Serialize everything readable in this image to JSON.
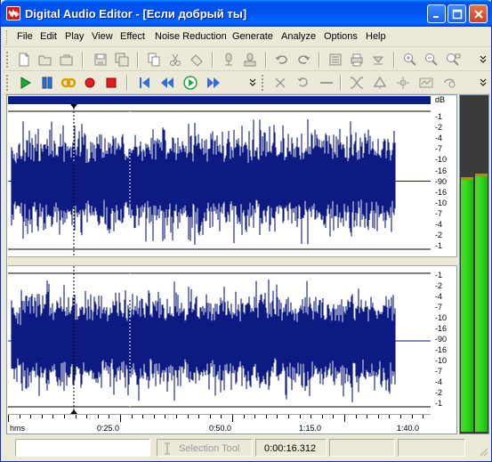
{
  "window": {
    "title": "Digital Audio Editor - [Если  добрый  ты]"
  },
  "menu": {
    "items": [
      "File",
      "Edit",
      "Play",
      "View",
      "Effect",
      "Noise Reduction",
      "Generate",
      "Analyze",
      "Options",
      "Help"
    ]
  },
  "toolbar1": {
    "icons": [
      "new-icon",
      "open-icon",
      "open-folder-icon",
      "save-icon",
      "save-all-icon",
      "copy-icon",
      "cut-icon",
      "paste-icon",
      "mic-icon",
      "mic-record-icon",
      "undo-icon",
      "redo-icon",
      "properties-icon",
      "print-icon",
      "down-arrow-icon",
      "zoom-in-icon",
      "zoom-out-icon",
      "zoom-fit-icon"
    ]
  },
  "toolbar2": {
    "icons": [
      "play-icon",
      "pause-icon",
      "loop-icon",
      "record-icon",
      "stop-icon",
      "go-start-icon",
      "rewind-icon",
      "play-cursor-icon",
      "fast-forward-icon"
    ],
    "right_icons": [
      "scissors-icon",
      "rotate-icon",
      "line-icon",
      "crossfade-icon",
      "marker-icon",
      "sparkle-icon",
      "equalizer-icon",
      "reverse-icon"
    ]
  },
  "db_scale_top": {
    "unit": "dB",
    "labels": [
      "-1",
      "-2",
      "-4",
      "-7",
      "-10",
      "-16",
      "-90",
      "-16",
      "-10",
      "-7",
      "-4",
      "-2",
      "-1"
    ]
  },
  "db_scale_bottom": {
    "labels": [
      "-1",
      "-2",
      "-4",
      "-7",
      "-10",
      "-16",
      "-90",
      "-16",
      "-10",
      "-7",
      "-4",
      "-2",
      "-1"
    ]
  },
  "time_ruler": {
    "labels": [
      "hms",
      "0:25.0",
      "0:50.0",
      "1:15.0",
      "1:40.0"
    ]
  },
  "meter": {
    "left_level": 0.76,
    "right_level": 0.77
  },
  "status": {
    "tool": "Selection Tool",
    "time": "0:00:16.312"
  },
  "colors": {
    "waveform": "#0c1a82",
    "titlebar": "#0054e3",
    "meter": "#2fd818"
  }
}
